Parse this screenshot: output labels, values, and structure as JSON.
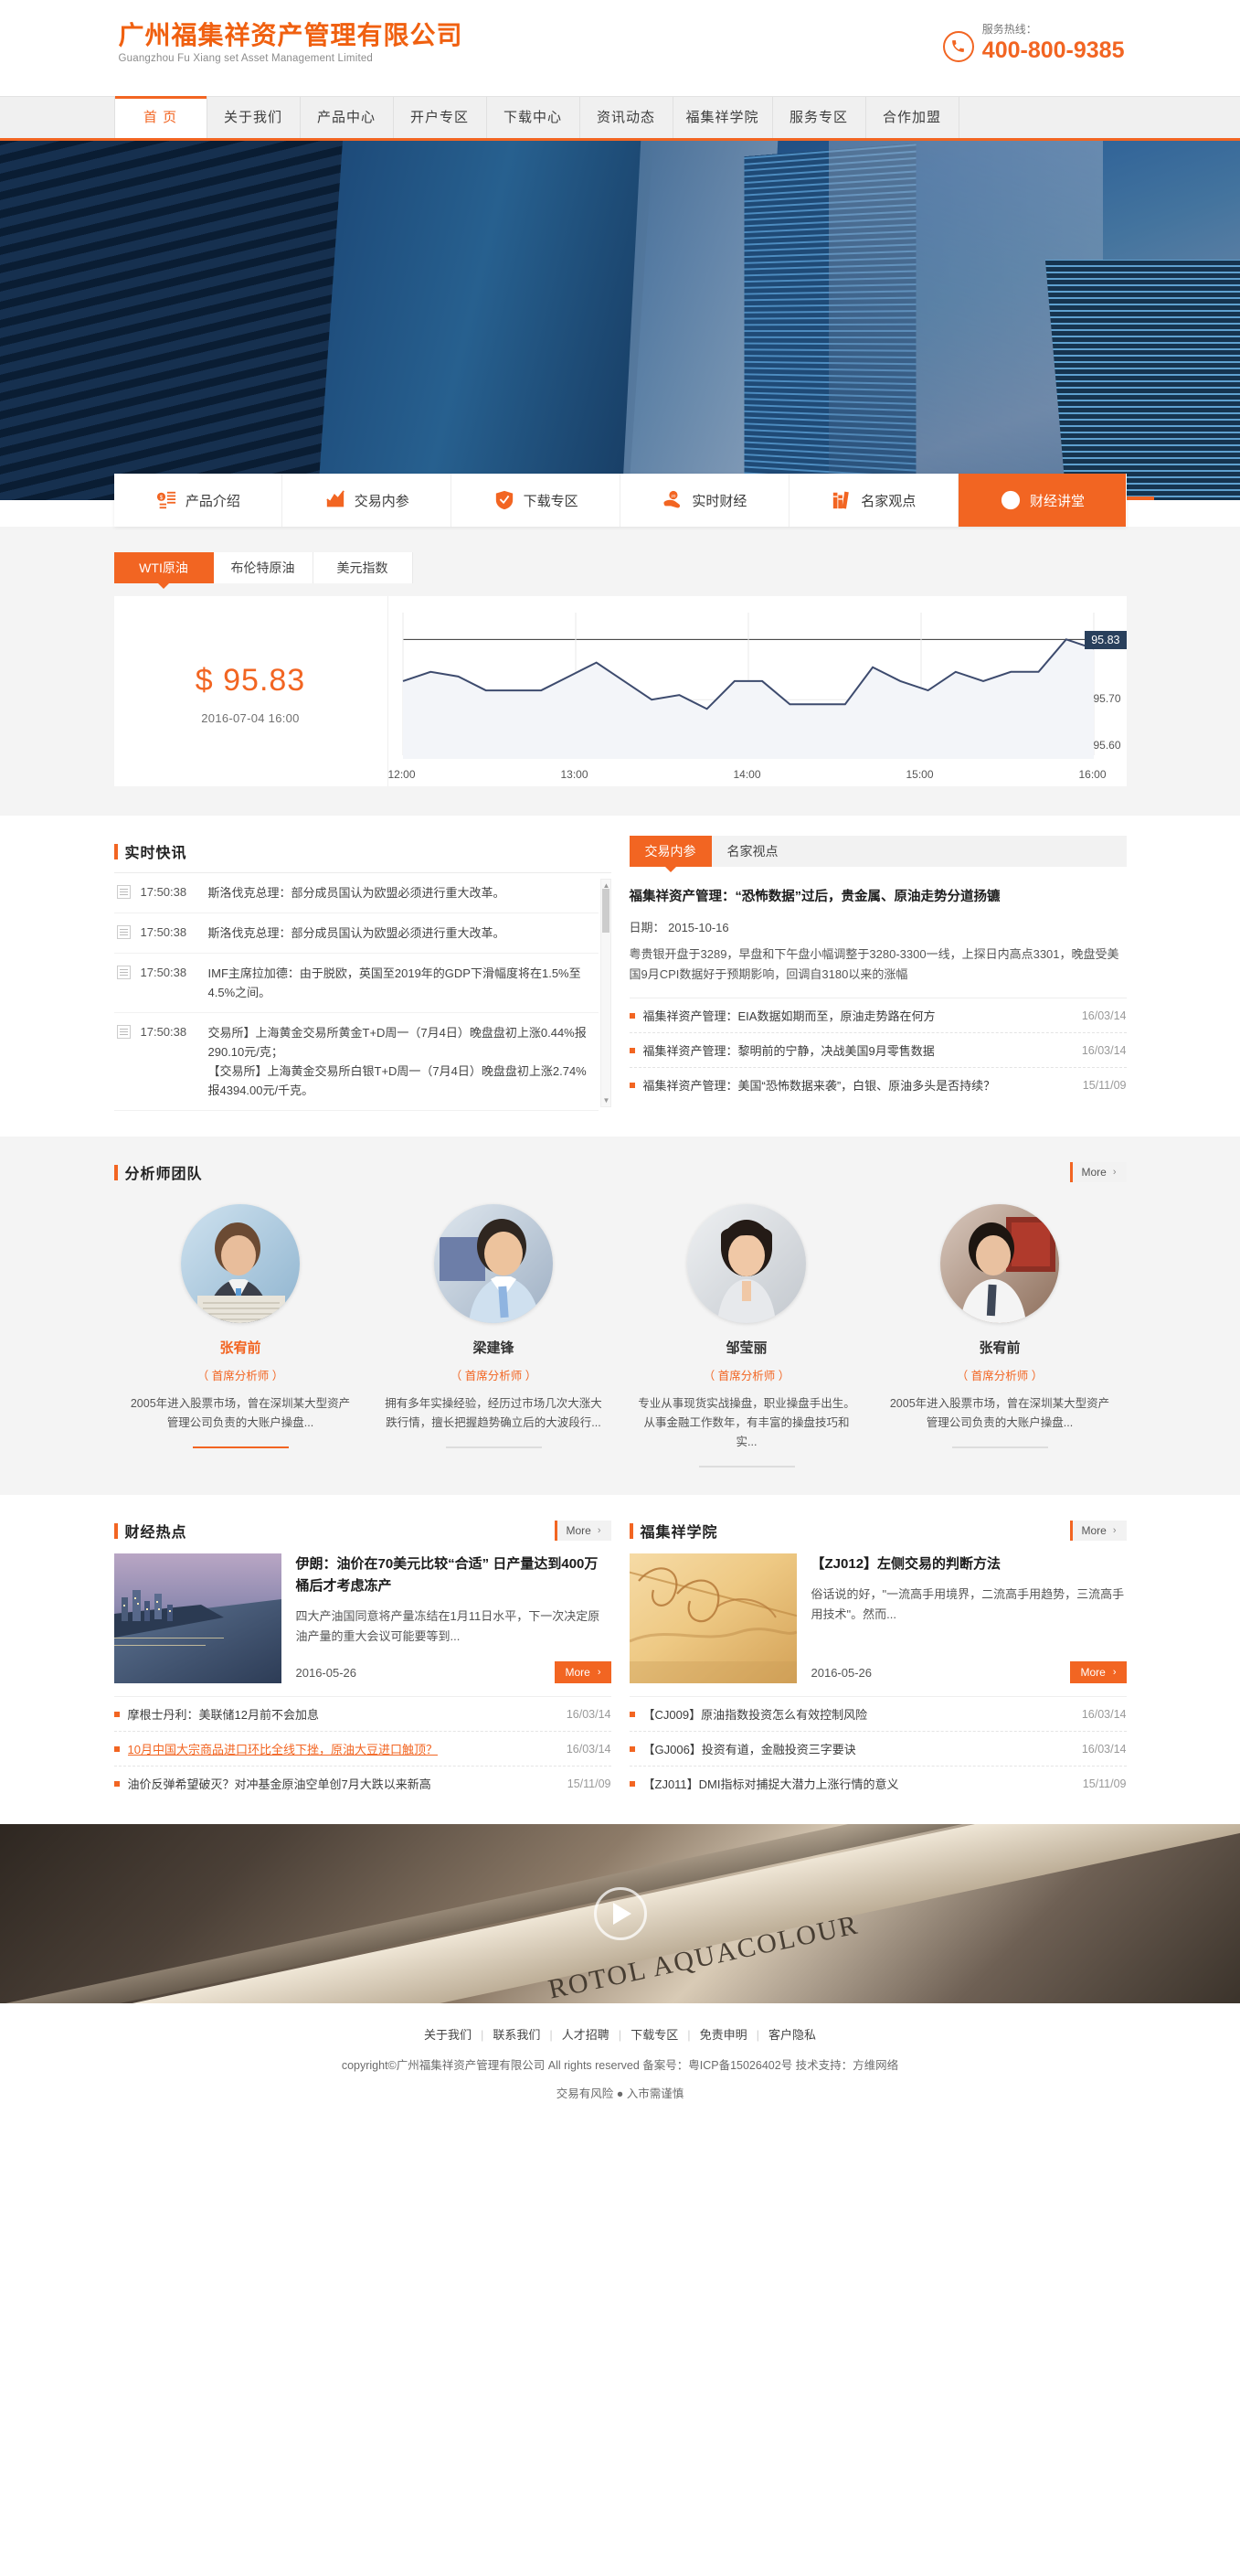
{
  "header": {
    "logo_cn": "广州福集祥资产管理有限公司",
    "logo_en": "Guangzhou Fu Xiang set Asset Management Limited",
    "hotline_label": "服务热线：",
    "hotline_number": "400-800-9385",
    "phone_icon": "phone-icon"
  },
  "nav": {
    "items": [
      {
        "label": "首 页",
        "active": true
      },
      {
        "label": "关于我们",
        "active": false
      },
      {
        "label": "产品中心",
        "active": false
      },
      {
        "label": "开户专区",
        "active": false
      },
      {
        "label": "下载中心",
        "active": false
      },
      {
        "label": "资讯动态",
        "active": false
      },
      {
        "label": "福集祥学院",
        "active": false
      },
      {
        "label": "服务专区",
        "active": false
      },
      {
        "label": "合作加盟",
        "active": false
      }
    ]
  },
  "quick_services": [
    {
      "label": "产品介绍",
      "icon": "list-money-icon",
      "active": false
    },
    {
      "label": "交易内参",
      "icon": "chart-up-icon",
      "active": false
    },
    {
      "label": "下载专区",
      "icon": "shield-check-icon",
      "active": false
    },
    {
      "label": "实时财经",
      "icon": "hand-coin-icon",
      "active": false
    },
    {
      "label": "名家观点",
      "icon": "books-icon",
      "active": false
    },
    {
      "label": "财经讲堂",
      "icon": "arrow-up-circle-icon",
      "active": true
    }
  ],
  "market": {
    "tabs": [
      {
        "label": "WTI原油",
        "active": true
      },
      {
        "label": "布伦特原油",
        "active": false
      },
      {
        "label": "美元指数",
        "active": false
      }
    ],
    "price": "$ 95.83",
    "timestamp": "2016-07-04  16:00"
  },
  "chart_data": {
    "type": "line",
    "title": "WTI原油",
    "xlabel": "",
    "ylabel": "",
    "x": [
      "12:00",
      "12:05",
      "12:10",
      "12:15",
      "12:20",
      "12:30",
      "12:45",
      "13:00",
      "13:10",
      "13:20",
      "13:30",
      "13:45",
      "14:00",
      "14:10",
      "14:20",
      "14:30",
      "14:45",
      "15:00",
      "15:05",
      "15:10",
      "15:15",
      "15:20",
      "15:30",
      "15:45",
      "16:00",
      "16:05"
    ],
    "values": [
      95.74,
      95.76,
      95.75,
      95.72,
      95.72,
      95.72,
      95.75,
      95.78,
      95.74,
      95.7,
      95.71,
      95.68,
      95.74,
      95.74,
      95.69,
      95.69,
      95.69,
      95.77,
      95.74,
      95.72,
      95.76,
      95.74,
      95.76,
      95.76,
      95.83,
      95.81
    ],
    "tick_labels_x": [
      "12:00",
      "13:00",
      "14:00",
      "15:00",
      "16:00"
    ],
    "tick_labels_y": [
      "95.83",
      "95.70",
      "95.60"
    ],
    "ylim": [
      95.58,
      95.88
    ],
    "current_value_badge": "95.83",
    "grid": true,
    "legend": "none",
    "line_color": "#3d4b6e",
    "fill_color": "#f3f5f9"
  },
  "flash": {
    "title": "实时快讯",
    "items": [
      {
        "time": "17:50:38",
        "text": "斯洛伐克总理：部分成员国认为欧盟必须进行重大改革。"
      },
      {
        "time": "17:50:38",
        "text": "斯洛伐克总理：部分成员国认为欧盟必须进行重大改革。"
      },
      {
        "time": "17:50:38",
        "text": "IMF主席拉加德：由于脱欧，英国至2019年的GDP下滑幅度将在1.5%至4.5%之间。"
      },
      {
        "time": "17:50:38",
        "text": "交易所】上海黄金交易所黄金T+D周一（7月4日）晚盘盘初上涨0.44%报290.10元/克；\n【交易所】上海黄金交易所白银T+D周一（7月4日）晚盘盘初上涨2.74%报4394.00元/千克。"
      }
    ]
  },
  "insight": {
    "tabs": [
      {
        "label": "交易内参",
        "active": true
      },
      {
        "label": "名家视点",
        "active": false
      }
    ],
    "article_title": "福集祥资产管理：“恐怖数据”过后，贵金属、原油走势分道扬镳",
    "article_date": "日期： 2015-10-16",
    "article_desc": "粤贵银开盘于3289，早盘和下午盘小幅调整于3280-3300一线，上探日内高点3301，晚盘受美国9月CPI数据好于预期影响，回调自3180以来的涨幅",
    "links": [
      {
        "text": "福集祥资产管理：EIA数据如期而至，原油走势路在何方",
        "date": "16/03/14"
      },
      {
        "text": "福集祥资产管理：黎明前的宁静，决战美国9月零售数据",
        "date": "16/03/14"
      },
      {
        "text": "福集祥资产管理：美国“恐怖数据来袭”，白银、原油多头是否持续？",
        "date": "15/11/09"
      }
    ]
  },
  "analysts": {
    "title": "分析师团队",
    "more": "More",
    "items": [
      {
        "name": "张宥前",
        "role": "（ 首席分析师 ）",
        "desc": "2005年进入股票市场，曾在深圳某大型资产管理公司负责的大账户操盘...",
        "highlight": true,
        "photo": "analyst-photo-1"
      },
      {
        "name": "梁建锋",
        "role": "（ 首席分析师 ）",
        "desc": "拥有多年实操经验，经历过市场几次大涨大跌行情，擅长把握趋势确立后的大波段行...",
        "highlight": false,
        "photo": "analyst-photo-2"
      },
      {
        "name": "邹莹丽",
        "role": "（ 首席分析师 ）",
        "desc": "专业从事现货实战操盘，职业操盘手出生。从事金融工作数年，有丰富的操盘技巧和实...",
        "highlight": false,
        "photo": "analyst-photo-3"
      },
      {
        "name": "张宥前",
        "role": "（ 首席分析师 ）",
        "desc": "2005年进入股票市场，曾在深圳某大型资产管理公司负责的大账户操盘...",
        "highlight": false,
        "photo": "analyst-photo-4"
      }
    ]
  },
  "hot": {
    "title": "财经热点",
    "more": "More",
    "feature": {
      "title": "伊朗：油价在70美元比较“合适” 日产量达到400万桶后才考虑冻产",
      "desc": "四大产油国同意将产量冻结在1月11日水平，下一次决定原油产量的重大会议可能要等到...",
      "date": "2016-05-26",
      "more": "More",
      "image": "city-river-night-photo"
    },
    "links": [
      {
        "text": "摩根士丹利：美联储12月前不会加息",
        "date": "16/03/14",
        "highlight": false
      },
      {
        "text": "10月中国大宗商品进口环比全线下挫，原油大豆进口触顶？",
        "date": "16/03/14",
        "highlight": true
      },
      {
        "text": "油价反弹希望破灭？对冲基金原油空单创7月大跌以来新高",
        "date": "15/11/09",
        "highlight": false
      }
    ]
  },
  "academy": {
    "title": "福集祥学院",
    "more": "More",
    "feature": {
      "title": "【ZJ012】左侧交易的判断方法",
      "desc": "俗话说的好，\"一流高手用境界，二流高手用趋势，三流高手用技术\"。然而...",
      "date": "2016-05-26",
      "more": "More",
      "image": "golden-calligraphy-photo"
    },
    "links": [
      {
        "text": "【CJ009】原油指数投资怎么有效控制风险",
        "date": "16/03/14",
        "highlight": false
      },
      {
        "text": "【GJ006】投资有道，金融投资三字要诀",
        "date": "16/03/14",
        "highlight": false
      },
      {
        "text": "【ZJ011】DMI指标对捕捉大潜力上涨行情的意义",
        "date": "15/11/09",
        "highlight": false
      }
    ]
  },
  "video": {
    "play_icon": "play-icon",
    "background_text": "ROTOL AQUACOLOUR"
  },
  "footer": {
    "links": [
      "关于我们",
      "联系我们",
      "人才招聘",
      "下载专区",
      "免责申明",
      "客户隐私"
    ],
    "copyright": "copyright©广州福集祥资产管理有限公司 All rights reserved  备案号：粤ICP备15026402号  技术支持：方维网络",
    "warning": "交易有风险 ● 入市需谨慎"
  },
  "colors": {
    "accent": "#f26522",
    "chart_line": "#3d4b6e",
    "badge_bg": "#29405c"
  }
}
